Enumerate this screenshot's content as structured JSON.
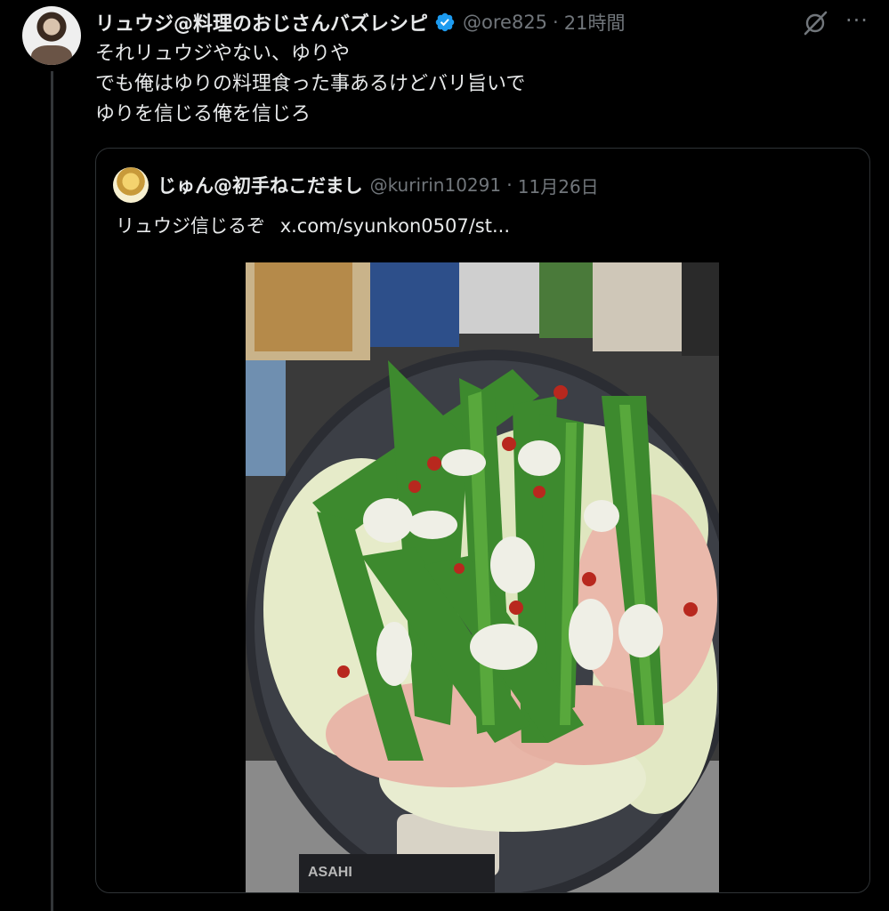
{
  "tweet": {
    "author_name": "リュウジ@料理のおじさんバズレシピ",
    "handle": "@ore825",
    "separator": "·",
    "time": "21時間",
    "lines": [
      "それリュウジやない、ゆりや",
      "でも俺はゆりの料理食った事あるけどバリ旨いで",
      "ゆりを信じる俺を信じろ"
    ],
    "icons": [
      "verified-badge-icon",
      "grok-icon",
      "more-icon"
    ],
    "more_label": "···"
  },
  "quote": {
    "author_name": "じゅん@初手ねこだまし",
    "handle": "@kuririn10291",
    "separator": "·",
    "time": "11月26日",
    "text": "リュウジ信じるぞ",
    "link": "x.com/syunkon0507/st..."
  },
  "colors": {
    "background": "#000000",
    "text": "#e7e9ea",
    "muted": "#71767b",
    "border": "#2f3336",
    "verified": "#1d9bf0"
  }
}
